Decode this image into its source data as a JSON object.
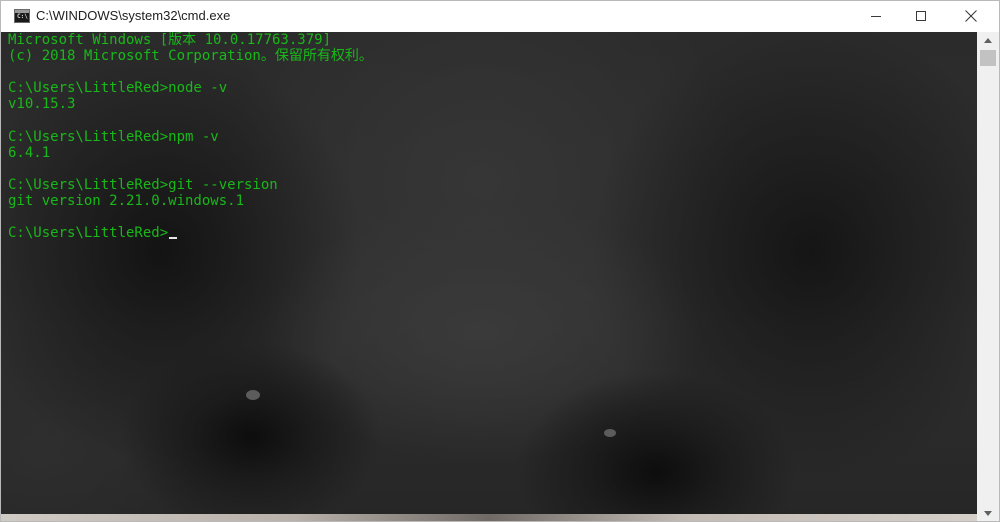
{
  "window": {
    "title": "C:\\WINDOWS\\system32\\cmd.exe",
    "icon": "cmd-icon",
    "icon_text": "C:\\",
    "controls": [
      "minimize-icon",
      "maximize-icon",
      "close-icon"
    ]
  },
  "console": {
    "background": "pug photo (dimmed)",
    "text_color": "#19b819",
    "lines": [
      "Microsoft Windows [版本 10.0.17763.379]",
      "(c) 2018 Microsoft Corporation。保留所有权利。",
      "",
      "C:\\Users\\LittleRed>node -v",
      "v10.15.3",
      "",
      "C:\\Users\\LittleRed>npm -v",
      "6.4.1",
      "",
      "C:\\Users\\LittleRed>git --version",
      "git version 2.21.0.windows.1",
      "",
      "C:\\Users\\LittleRed>"
    ]
  },
  "scrollbar": {
    "up_icon": "arrow-up-icon",
    "down_icon": "arrow-down-icon"
  }
}
